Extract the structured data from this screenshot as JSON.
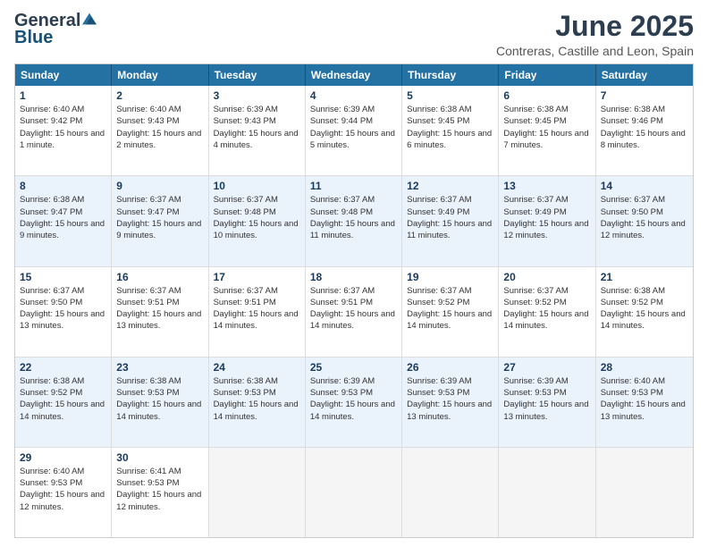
{
  "header": {
    "logo_general": "General",
    "logo_blue": "Blue",
    "month_title": "June 2025",
    "location": "Contreras, Castille and Leon, Spain"
  },
  "weekdays": [
    "Sunday",
    "Monday",
    "Tuesday",
    "Wednesday",
    "Thursday",
    "Friday",
    "Saturday"
  ],
  "rows": [
    [
      {
        "day": "1",
        "sunrise": "Sunrise: 6:40 AM",
        "sunset": "Sunset: 9:42 PM",
        "daylight": "Daylight: 15 hours and 1 minute.",
        "empty": false,
        "alt": false
      },
      {
        "day": "2",
        "sunrise": "Sunrise: 6:40 AM",
        "sunset": "Sunset: 9:43 PM",
        "daylight": "Daylight: 15 hours and 2 minutes.",
        "empty": false,
        "alt": false
      },
      {
        "day": "3",
        "sunrise": "Sunrise: 6:39 AM",
        "sunset": "Sunset: 9:43 PM",
        "daylight": "Daylight: 15 hours and 4 minutes.",
        "empty": false,
        "alt": false
      },
      {
        "day": "4",
        "sunrise": "Sunrise: 6:39 AM",
        "sunset": "Sunset: 9:44 PM",
        "daylight": "Daylight: 15 hours and 5 minutes.",
        "empty": false,
        "alt": false
      },
      {
        "day": "5",
        "sunrise": "Sunrise: 6:38 AM",
        "sunset": "Sunset: 9:45 PM",
        "daylight": "Daylight: 15 hours and 6 minutes.",
        "empty": false,
        "alt": false
      },
      {
        "day": "6",
        "sunrise": "Sunrise: 6:38 AM",
        "sunset": "Sunset: 9:45 PM",
        "daylight": "Daylight: 15 hours and 7 minutes.",
        "empty": false,
        "alt": false
      },
      {
        "day": "7",
        "sunrise": "Sunrise: 6:38 AM",
        "sunset": "Sunset: 9:46 PM",
        "daylight": "Daylight: 15 hours and 8 minutes.",
        "empty": false,
        "alt": false
      }
    ],
    [
      {
        "day": "8",
        "sunrise": "Sunrise: 6:38 AM",
        "sunset": "Sunset: 9:47 PM",
        "daylight": "Daylight: 15 hours and 9 minutes.",
        "empty": false,
        "alt": true
      },
      {
        "day": "9",
        "sunrise": "Sunrise: 6:37 AM",
        "sunset": "Sunset: 9:47 PM",
        "daylight": "Daylight: 15 hours and 9 minutes.",
        "empty": false,
        "alt": true
      },
      {
        "day": "10",
        "sunrise": "Sunrise: 6:37 AM",
        "sunset": "Sunset: 9:48 PM",
        "daylight": "Daylight: 15 hours and 10 minutes.",
        "empty": false,
        "alt": true
      },
      {
        "day": "11",
        "sunrise": "Sunrise: 6:37 AM",
        "sunset": "Sunset: 9:48 PM",
        "daylight": "Daylight: 15 hours and 11 minutes.",
        "empty": false,
        "alt": true
      },
      {
        "day": "12",
        "sunrise": "Sunrise: 6:37 AM",
        "sunset": "Sunset: 9:49 PM",
        "daylight": "Daylight: 15 hours and 11 minutes.",
        "empty": false,
        "alt": true
      },
      {
        "day": "13",
        "sunrise": "Sunrise: 6:37 AM",
        "sunset": "Sunset: 9:49 PM",
        "daylight": "Daylight: 15 hours and 12 minutes.",
        "empty": false,
        "alt": true
      },
      {
        "day": "14",
        "sunrise": "Sunrise: 6:37 AM",
        "sunset": "Sunset: 9:50 PM",
        "daylight": "Daylight: 15 hours and 12 minutes.",
        "empty": false,
        "alt": true
      }
    ],
    [
      {
        "day": "15",
        "sunrise": "Sunrise: 6:37 AM",
        "sunset": "Sunset: 9:50 PM",
        "daylight": "Daylight: 15 hours and 13 minutes.",
        "empty": false,
        "alt": false
      },
      {
        "day": "16",
        "sunrise": "Sunrise: 6:37 AM",
        "sunset": "Sunset: 9:51 PM",
        "daylight": "Daylight: 15 hours and 13 minutes.",
        "empty": false,
        "alt": false
      },
      {
        "day": "17",
        "sunrise": "Sunrise: 6:37 AM",
        "sunset": "Sunset: 9:51 PM",
        "daylight": "Daylight: 15 hours and 14 minutes.",
        "empty": false,
        "alt": false
      },
      {
        "day": "18",
        "sunrise": "Sunrise: 6:37 AM",
        "sunset": "Sunset: 9:51 PM",
        "daylight": "Daylight: 15 hours and 14 minutes.",
        "empty": false,
        "alt": false
      },
      {
        "day": "19",
        "sunrise": "Sunrise: 6:37 AM",
        "sunset": "Sunset: 9:52 PM",
        "daylight": "Daylight: 15 hours and 14 minutes.",
        "empty": false,
        "alt": false
      },
      {
        "day": "20",
        "sunrise": "Sunrise: 6:37 AM",
        "sunset": "Sunset: 9:52 PM",
        "daylight": "Daylight: 15 hours and 14 minutes.",
        "empty": false,
        "alt": false
      },
      {
        "day": "21",
        "sunrise": "Sunrise: 6:38 AM",
        "sunset": "Sunset: 9:52 PM",
        "daylight": "Daylight: 15 hours and 14 minutes.",
        "empty": false,
        "alt": false
      }
    ],
    [
      {
        "day": "22",
        "sunrise": "Sunrise: 6:38 AM",
        "sunset": "Sunset: 9:52 PM",
        "daylight": "Daylight: 15 hours and 14 minutes.",
        "empty": false,
        "alt": true
      },
      {
        "day": "23",
        "sunrise": "Sunrise: 6:38 AM",
        "sunset": "Sunset: 9:53 PM",
        "daylight": "Daylight: 15 hours and 14 minutes.",
        "empty": false,
        "alt": true
      },
      {
        "day": "24",
        "sunrise": "Sunrise: 6:38 AM",
        "sunset": "Sunset: 9:53 PM",
        "daylight": "Daylight: 15 hours and 14 minutes.",
        "empty": false,
        "alt": true
      },
      {
        "day": "25",
        "sunrise": "Sunrise: 6:39 AM",
        "sunset": "Sunset: 9:53 PM",
        "daylight": "Daylight: 15 hours and 14 minutes.",
        "empty": false,
        "alt": true
      },
      {
        "day": "26",
        "sunrise": "Sunrise: 6:39 AM",
        "sunset": "Sunset: 9:53 PM",
        "daylight": "Daylight: 15 hours and 13 minutes.",
        "empty": false,
        "alt": true
      },
      {
        "day": "27",
        "sunrise": "Sunrise: 6:39 AM",
        "sunset": "Sunset: 9:53 PM",
        "daylight": "Daylight: 15 hours and 13 minutes.",
        "empty": false,
        "alt": true
      },
      {
        "day": "28",
        "sunrise": "Sunrise: 6:40 AM",
        "sunset": "Sunset: 9:53 PM",
        "daylight": "Daylight: 15 hours and 13 minutes.",
        "empty": false,
        "alt": true
      }
    ],
    [
      {
        "day": "29",
        "sunrise": "Sunrise: 6:40 AM",
        "sunset": "Sunset: 9:53 PM",
        "daylight": "Daylight: 15 hours and 12 minutes.",
        "empty": false,
        "alt": false
      },
      {
        "day": "30",
        "sunrise": "Sunrise: 6:41 AM",
        "sunset": "Sunset: 9:53 PM",
        "daylight": "Daylight: 15 hours and 12 minutes.",
        "empty": false,
        "alt": false
      },
      {
        "day": "",
        "sunrise": "",
        "sunset": "",
        "daylight": "",
        "empty": true,
        "alt": false
      },
      {
        "day": "",
        "sunrise": "",
        "sunset": "",
        "daylight": "",
        "empty": true,
        "alt": false
      },
      {
        "day": "",
        "sunrise": "",
        "sunset": "",
        "daylight": "",
        "empty": true,
        "alt": false
      },
      {
        "day": "",
        "sunrise": "",
        "sunset": "",
        "daylight": "",
        "empty": true,
        "alt": false
      },
      {
        "day": "",
        "sunrise": "",
        "sunset": "",
        "daylight": "",
        "empty": true,
        "alt": false
      }
    ]
  ]
}
